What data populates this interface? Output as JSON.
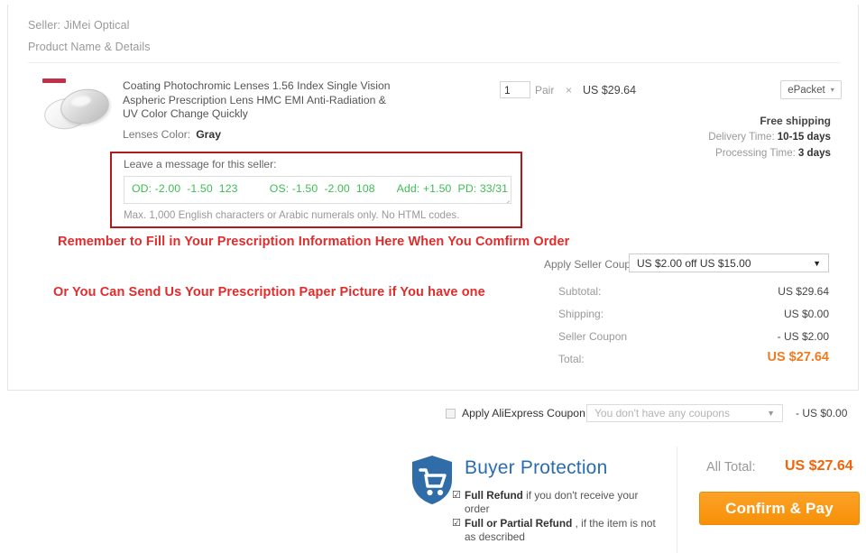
{
  "card": {
    "seller_line": "Seller: JiMei Optical",
    "product_head": "Product Name & Details",
    "product": {
      "title": "Coating Photochromic Lenses 1.56 Index Single Vision Aspheric Prescription Lens HMC EMI Anti-Radiation & UV Color Change Quickly",
      "lens_color_label": "Lenses Color:",
      "lens_color_value": "Gray"
    },
    "quantity": {
      "value": "1",
      "unit": "Pair",
      "times": "×",
      "unit_price": "US $29.64"
    },
    "shipping": {
      "method": "ePacket",
      "caret": "▾",
      "free_shipping": "Free shipping",
      "delivery_time_label": "Delivery Time:",
      "delivery_time_value": "10-15 days",
      "processing_time_label": "Processing Time:",
      "processing_time_value": "3 days"
    },
    "message": {
      "label": "Leave a message for this seller:",
      "value": "OD: -2.00  -1.50  123          OS: -1.50  -2.00  108       Add: +1.50  PD: 33/31",
      "hint": "Max. 1,000 English characters or Arabic numerals only. No HTML codes."
    },
    "annotations": {
      "line1": "Remember to Fill in Your Prescription Information Here When You Comfirm Order",
      "line2": "Or You Can Send Us Your Prescription Paper Picture if You have one",
      "color": "#e02c2c",
      "box_color": "#b11b1b"
    },
    "seller_coupon": {
      "label": "Apply Seller Coupon:",
      "selected": "US $2.00 off US $15.00",
      "caret": "▼"
    },
    "totals": [
      {
        "label": "Subtotal:",
        "value": "US $29.64"
      },
      {
        "label": "Shipping:",
        "value": "US $0.00"
      },
      {
        "label": "Seller Coupon",
        "value": "- US $2.00"
      },
      {
        "label": "Total:",
        "value": "US $27.64"
      }
    ]
  },
  "ae_coupon": {
    "label": "Apply AliExpress Coupon:",
    "placeholder": "You don't have any coupons",
    "caret": "▼",
    "amount": "- US $0.00"
  },
  "buyer_protection": {
    "title": "Buyer Protection",
    "title_color": "#2b6cb0",
    "items": [
      {
        "tick": "☑",
        "strong": "Full Refund",
        "rest": " if you don't receive your order"
      },
      {
        "tick": "☑",
        "strong": "Full or Partial Refund",
        "rest": " , if the item is not as described"
      }
    ]
  },
  "checkout": {
    "all_total_label": "All Total:",
    "all_total_value": "US $27.64",
    "all_total_color": "#f0640a",
    "pay_button": "Confirm & Pay",
    "pay_button_color": "#f79008"
  }
}
